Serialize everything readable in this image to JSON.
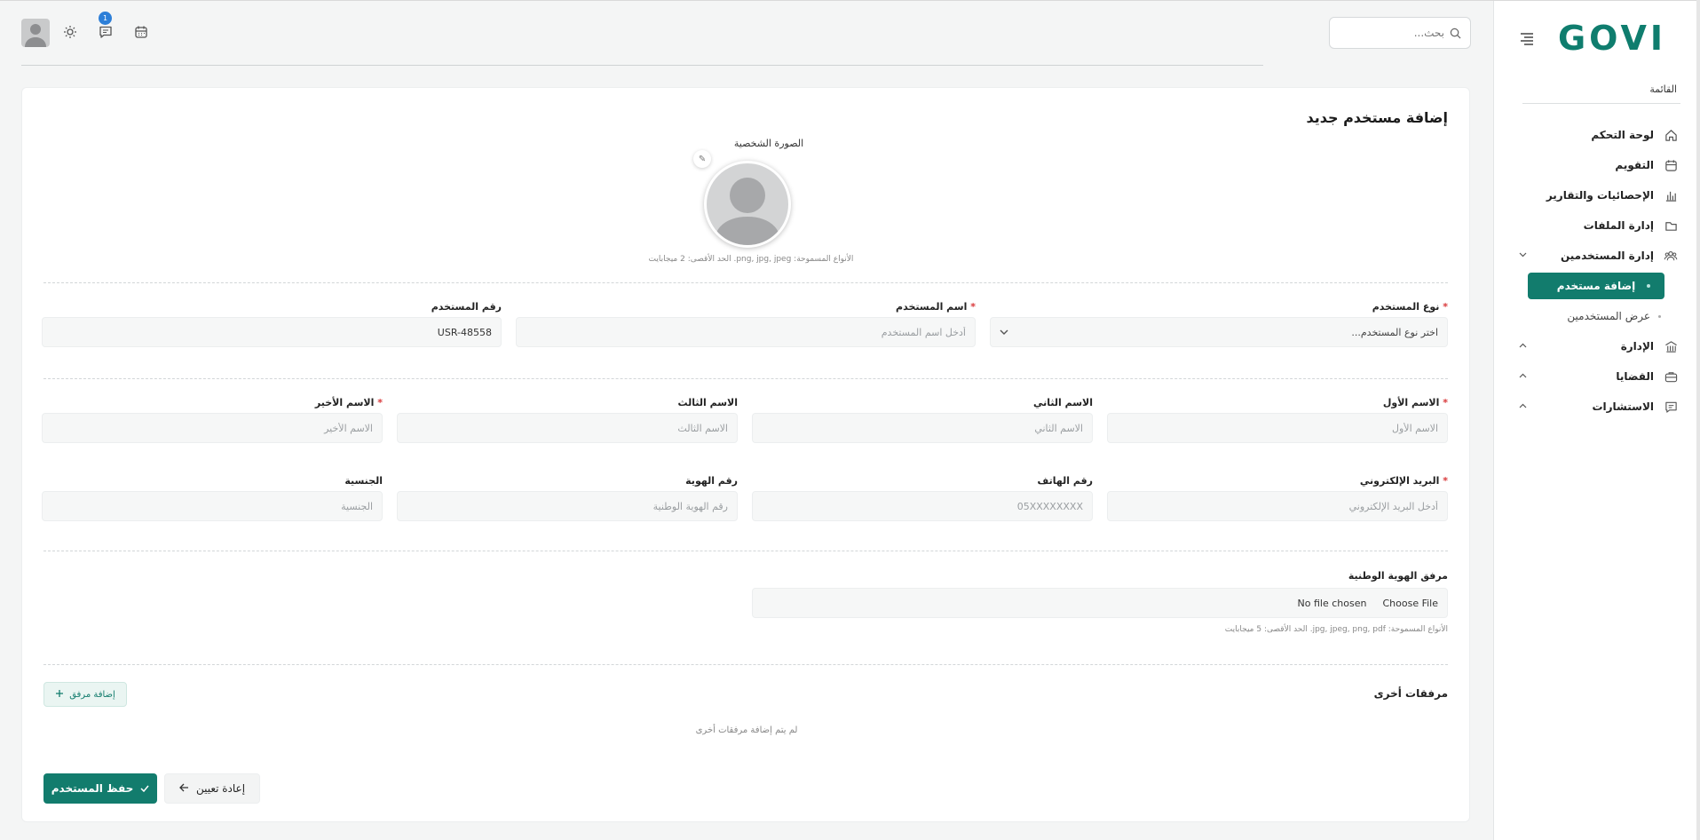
{
  "sidebar": {
    "logo": "GOVI",
    "menu_heading": "القائمة",
    "items": [
      {
        "label": "لوحة التحكم",
        "icon": "home-icon"
      },
      {
        "label": "التقويم",
        "icon": "calendar-icon"
      },
      {
        "label": "الإحصائيات والتقارير",
        "icon": "bar-chart-icon"
      },
      {
        "label": "إدارة الملفات",
        "icon": "folder-icon"
      },
      {
        "label": "إدارة المستخدمين",
        "icon": "users-icon"
      }
    ],
    "users_sub": {
      "active": "إضافة مستخدم",
      "other": "عرض المستخدمين"
    },
    "collapsed": [
      {
        "label": "الإدارة",
        "icon": "building-icon"
      },
      {
        "label": "القضايا",
        "icon": "briefcase-icon"
      },
      {
        "label": "الاستشارات",
        "icon": "chat-icon"
      }
    ]
  },
  "header": {
    "search_placeholder": "بحث...",
    "notification_count": "1"
  },
  "form": {
    "title": "إضافة مستخدم جديد",
    "photo_label": "الصورة الشخصية",
    "photo_hint": "الأنواع المسموحة: png, jpg, jpeg. الحد الأقصى: 2 ميجابايت",
    "user_type": {
      "label": "نوع المستخدم",
      "placeholder": "اختر نوع المستخدم..."
    },
    "username": {
      "label": "اسم المستخدم",
      "placeholder": "أدخل اسم المستخدم"
    },
    "user_number": {
      "label": "رقم المستخدم",
      "value": "USR-48558"
    },
    "first_name": {
      "label": "الاسم الأول",
      "placeholder": "الاسم الأول"
    },
    "second_name": {
      "label": "الاسم الثاني",
      "placeholder": "الاسم الثاني"
    },
    "third_name": {
      "label": "الاسم الثالث",
      "placeholder": "الاسم الثالث"
    },
    "last_name": {
      "label": "الاسم الأخير",
      "placeholder": "الاسم الأخير"
    },
    "email": {
      "label": "البريد الإلكتروني",
      "placeholder": "أدخل البريد الإلكتروني"
    },
    "phone": {
      "label": "رقم الهاتف",
      "placeholder": "05XXXXXXXX"
    },
    "id_number": {
      "label": "رقم الهوية",
      "placeholder": "رقم الهوية الوطنية"
    },
    "nationality": {
      "label": "الجنسية",
      "placeholder": "الجنسية"
    },
    "id_attachment": {
      "label": "مرفق الهوية الوطنية",
      "choose": "Choose File",
      "status": "No file chosen",
      "hint": "الأنواع المسموحة: jpg, jpeg, png, pdf. الحد الأقصى: 5 ميجابايت"
    },
    "other_attachments": {
      "label": "مرفقات أخرى",
      "add_button": "إضافة مرفق",
      "empty": "لم يتم إضافة مرفقات أخرى"
    },
    "save_button": "حفظ المستخدم",
    "reset_button": "إعادة تعيين"
  },
  "colors": {
    "brand": "#127c6d",
    "required": "#d9383a",
    "badge": "#2d7fd8"
  }
}
